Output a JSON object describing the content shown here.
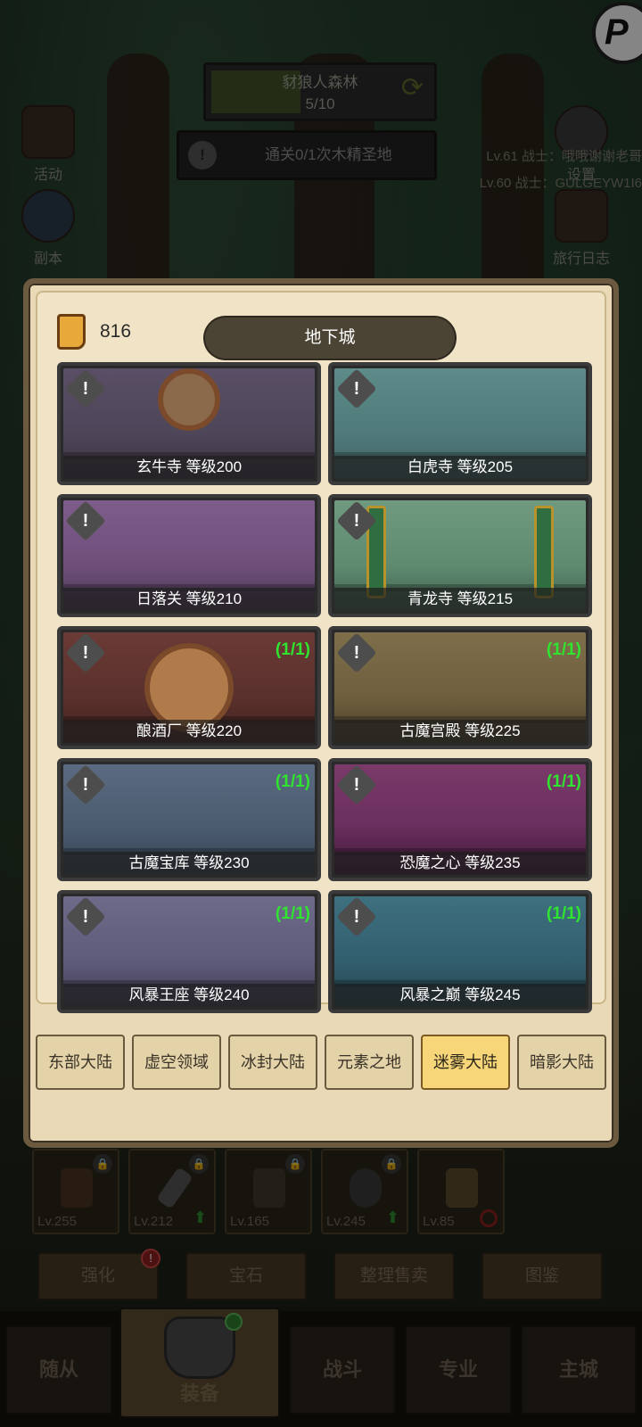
{
  "background": {
    "stage_name": "豺狼人森林",
    "stage_progress": "5/10",
    "quest_text": "通关0/1次木精圣地",
    "left_menu": [
      {
        "label": "活动",
        "icon": "scroll-icon"
      },
      {
        "label": "副本",
        "icon": "portal-icon"
      }
    ],
    "right_menu": [
      {
        "label": "设置",
        "icon": "gear-icon"
      },
      {
        "label": "旅行日志",
        "icon": "book-icon"
      }
    ],
    "chat_lines": [
      "Lv.61 战士：哦哦谢谢老哥",
      "Lv.60 战士：GULGEYW1I6"
    ],
    "corner_badge": "P"
  },
  "modal": {
    "currency_value": "816",
    "currency_icon": "scroll-icon",
    "title": "地下城",
    "dungeons": [
      {
        "name": "玄牛寺 等级200",
        "count": ""
      },
      {
        "name": "白虎寺 等级205",
        "count": ""
      },
      {
        "name": "日落关 等级210",
        "count": ""
      },
      {
        "name": "青龙寺 等级215",
        "count": ""
      },
      {
        "name": "酿酒厂 等级220",
        "count": "(1/1)"
      },
      {
        "name": "古魔宫殿 等级225",
        "count": "(1/1)"
      },
      {
        "name": "古魔宝库 等级230",
        "count": "(1/1)"
      },
      {
        "name": "恐魔之心 等级235",
        "count": "(1/1)"
      },
      {
        "name": "风暴王座 等级240",
        "count": "(1/1)"
      },
      {
        "name": "风暴之巅 等级245",
        "count": "(1/1)"
      }
    ],
    "regions": [
      "东部大陆",
      "虚空领域",
      "冰封大陆",
      "元素之地",
      "迷雾大陆",
      "暗影大陆"
    ],
    "active_region": "迷雾大陆"
  },
  "equipment": [
    {
      "level": "Lv.255",
      "upgrade": false,
      "blocked": false
    },
    {
      "level": "Lv.212",
      "upgrade": true,
      "blocked": false
    },
    {
      "level": "Lv.165",
      "upgrade": false,
      "blocked": false
    },
    {
      "level": "Lv.245",
      "upgrade": true,
      "blocked": false
    },
    {
      "level": "Lv.85",
      "upgrade": false,
      "blocked": true
    }
  ],
  "actions": [
    {
      "label": "强化",
      "badge": "!"
    },
    {
      "label": "宝石",
      "badge": ""
    },
    {
      "label": "整理售卖",
      "badge": ""
    },
    {
      "label": "图鉴",
      "badge": ""
    }
  ],
  "tabs": [
    "随从",
    "装备",
    "战斗",
    "专业",
    "主城"
  ],
  "active_tab": "装备"
}
